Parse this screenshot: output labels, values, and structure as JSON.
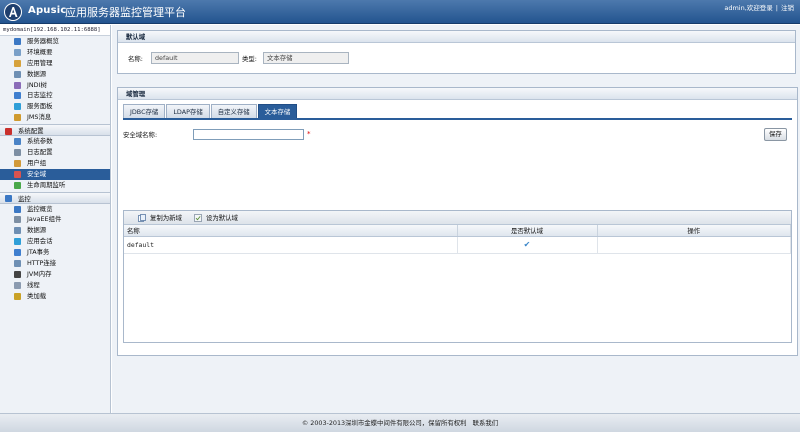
{
  "header": {
    "brand": "Apusic",
    "title": "应用服务器监控管理平台",
    "user_text": "admin,欢迎登录",
    "separator": "|",
    "logout": "注销"
  },
  "sidebar": {
    "domain": "mydomain[192.168.102.11:6888]",
    "group1": [
      {
        "label": "服务器概览",
        "icon": "server-icon",
        "color": "#3b78c4"
      },
      {
        "label": "环境概要",
        "icon": "environment-icon",
        "color": "#7aa0c8"
      },
      {
        "label": "应用管理",
        "icon": "application-icon",
        "color": "#d6a23c"
      },
      {
        "label": "数据源",
        "icon": "datasource-icon",
        "color": "#6e8fb3"
      },
      {
        "label": "JNDI树",
        "icon": "jndi-tree-icon",
        "color": "#8a6cb8"
      },
      {
        "label": "日志监控",
        "icon": "log-monitor-icon",
        "color": "#3f7fcf"
      },
      {
        "label": "服务面板",
        "icon": "service-panel-icon",
        "color": "#2f9fd8"
      },
      {
        "label": "JMS消息",
        "icon": "jms-message-icon",
        "color": "#cf9a2e"
      }
    ],
    "section_config": {
      "label": "系统配置",
      "icon": "system-config-icon",
      "color": "#c9302c"
    },
    "group2": [
      {
        "label": "系统参数",
        "icon": "system-params-icon",
        "color": "#4a83c6"
      },
      {
        "label": "日志配置",
        "icon": "log-config-icon",
        "color": "#7d8fa3"
      },
      {
        "label": "用户组",
        "icon": "user-group-icon",
        "color": "#d29a3a"
      },
      {
        "label": "安全域",
        "icon": "security-domain-icon",
        "color": "#d9534f"
      },
      {
        "label": "生命周期监听",
        "icon": "lifecycle-listener-icon",
        "color": "#49a84a"
      }
    ],
    "section_monitor": {
      "label": "监控",
      "icon": "monitor-icon",
      "color": "#3b78c4"
    },
    "group3": [
      {
        "label": "监控概览",
        "icon": "monitor-overview-icon",
        "color": "#3b78c4"
      },
      {
        "label": "JavaEE组件",
        "icon": "javaee-component-icon",
        "color": "#7d8fa3"
      },
      {
        "label": "数据源",
        "icon": "datasource-monitor-icon",
        "color": "#6e8fb3"
      },
      {
        "label": "应用会话",
        "icon": "app-session-icon",
        "color": "#2f9fd8"
      },
      {
        "label": "JTA事务",
        "icon": "jta-transaction-icon",
        "color": "#3f7fcf"
      },
      {
        "label": "HTTP连接",
        "icon": "http-connection-icon",
        "color": "#6e8fb3"
      },
      {
        "label": "JVM内存",
        "icon": "jvm-memory-icon",
        "color": "#444444"
      },
      {
        "label": "线程",
        "icon": "thread-icon",
        "color": "#8b9bb0"
      },
      {
        "label": "类加载",
        "icon": "class-loader-icon",
        "color": "#c9a227"
      }
    ],
    "active_item": "安全域"
  },
  "default_domain": {
    "title": "默认域",
    "name_label": "名称:",
    "name_value": "default",
    "type_label": "类型:",
    "type_value": "文本存储"
  },
  "domain_mgmt": {
    "title": "域管理",
    "tabs": [
      "JDBC存储",
      "LDAP存储",
      "自定义存储",
      "文本存储"
    ],
    "active_tab": "文本存储",
    "security_name_label": "安全域名称:",
    "security_name_value": "",
    "required_mark": "*",
    "save_label": "保存",
    "toolbar": {
      "copy_label": "复制为新域",
      "set_default_label": "设为默认域"
    },
    "columns": [
      "名称",
      "是否默认域",
      "操作"
    ],
    "rows": [
      {
        "name": "default",
        "is_default": "✔",
        "action": ""
      }
    ]
  },
  "footer": {
    "text": "© 2003-2013深圳市金蝶中间件有限公司，保留所有权利",
    "contact": "联系我们"
  },
  "colors": {
    "header_bg": "#2d5f98",
    "active_bg": "#2a5d9a",
    "panel_border": "#a9b8cb",
    "required": "#dd0000",
    "check": "#3a86c9"
  }
}
